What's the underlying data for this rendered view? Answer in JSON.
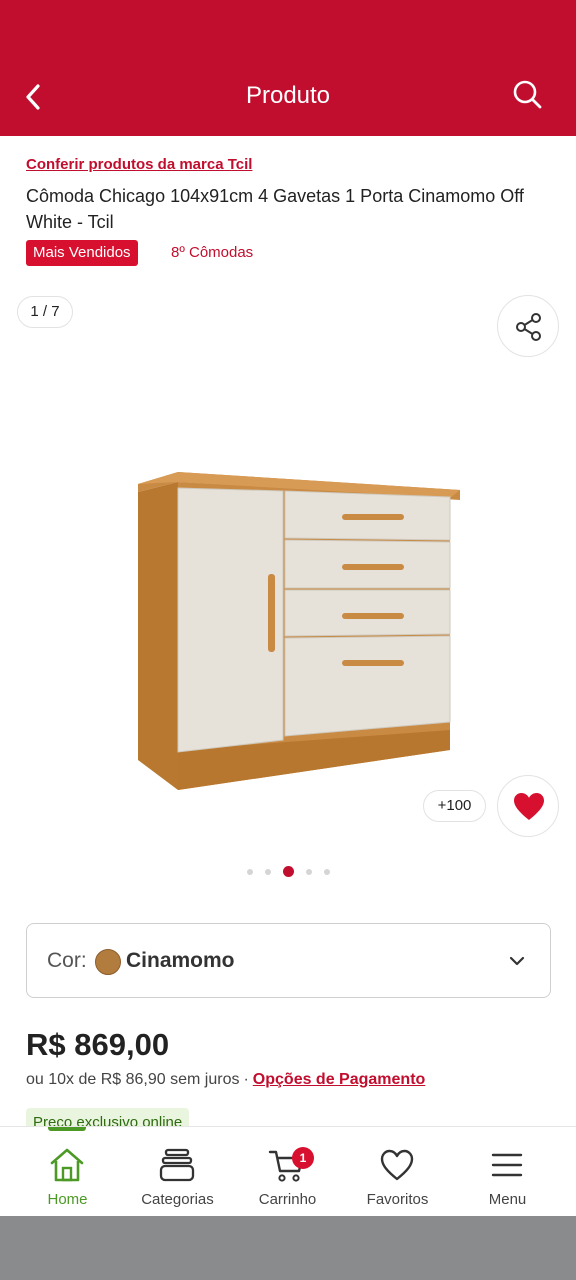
{
  "header": {
    "title": "Produto"
  },
  "product": {
    "brand_link": "Conferir produtos da marca Tcil",
    "title": "Cômoda Chicago 104x91cm 4 Gavetas 1 Porta Cinamomo Off White - Tcil",
    "badge": "Mais Vendidos",
    "rank": "8º Cômodas"
  },
  "gallery": {
    "counter": "1 / 7",
    "favorites_count": "+100",
    "total_images": 5,
    "active_index": 2
  },
  "color": {
    "label": "Cor:",
    "value": "Cinamomo",
    "swatch": "#b27c3e"
  },
  "pricing": {
    "price": "R$ 869,00",
    "installments": "ou 10x de R$ 86,90 sem juros",
    "separator": "·",
    "payment_options": "Opções de Pagamento",
    "exclusive": "Preço exclusivo online"
  },
  "nav": {
    "items": [
      {
        "label": "Home",
        "icon": "home-icon"
      },
      {
        "label": "Categorias",
        "icon": "categories-icon"
      },
      {
        "label": "Carrinho",
        "icon": "cart-icon",
        "badge": "1"
      },
      {
        "label": "Favoritos",
        "icon": "heart-icon"
      },
      {
        "label": "Menu",
        "icon": "menu-icon"
      }
    ],
    "active": "Home"
  },
  "colors": {
    "brand": "#c20e2e",
    "nav_active": "#4c9a25"
  }
}
